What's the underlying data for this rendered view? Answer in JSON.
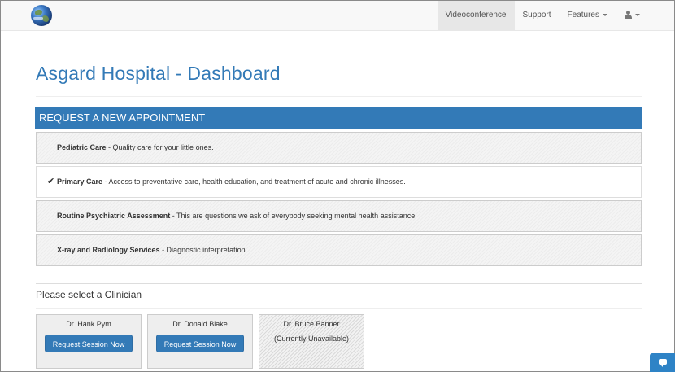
{
  "nav": {
    "items": [
      {
        "label": "Videoconference",
        "active": true
      },
      {
        "label": "Support",
        "active": false
      },
      {
        "label": "Features",
        "active": false
      }
    ]
  },
  "page": {
    "title": "Asgard Hospital - Dashboard"
  },
  "appointment": {
    "heading": "REQUEST A NEW APPOINTMENT",
    "services": [
      {
        "name": "Pediatric Care",
        "desc": " - Quality care for your little ones.",
        "selected": false
      },
      {
        "name": "Primary Care",
        "desc": " - Access to preventative care, health education, and treatment of acute and chronic illnesses.",
        "selected": true
      },
      {
        "name": "Routine Psychiatric Assessment",
        "desc": " - This are questions we ask of everybody seeking mental health assistance.",
        "selected": false
      },
      {
        "name": "X-ray and Radiology Services",
        "desc": " - Diagnostic interpretation",
        "selected": false
      }
    ]
  },
  "clinicians": {
    "heading": "Please select a Clinician",
    "list": [
      {
        "name": "Dr. Hank Pym",
        "button": "Request Session Now"
      },
      {
        "name": "Dr. Donald Blake",
        "button": "Request Session Now"
      },
      {
        "name": "Dr. Bruce Banner",
        "status": "(Currently Unavailable)"
      }
    ]
  },
  "colors": {
    "accent": "#337ab7",
    "navbar_bg": "#f8f8f8"
  },
  "icons": {
    "logo": "globe-icon",
    "user": "user-icon",
    "check": "checkmark-icon",
    "chat": "chat-icon"
  }
}
